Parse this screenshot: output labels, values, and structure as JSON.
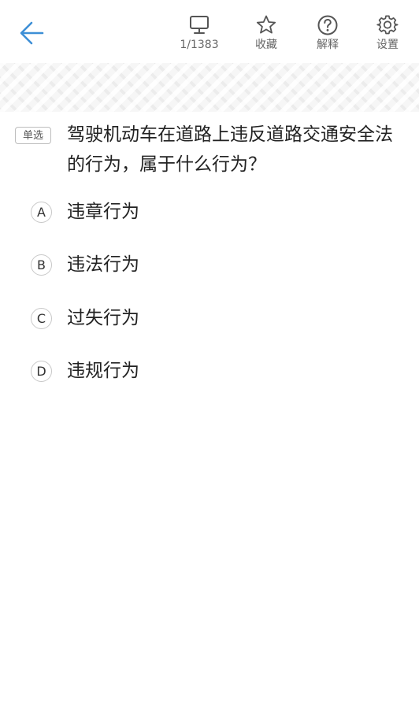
{
  "header": {
    "back_icon": "arrow-left-icon",
    "accent_color": "#3d8fd6",
    "tools": [
      {
        "icon": "monitor-icon",
        "label": "1/1383"
      },
      {
        "icon": "star-icon",
        "label": "收藏"
      },
      {
        "icon": "question-circle-icon",
        "label": "解释"
      },
      {
        "icon": "gear-icon",
        "label": "设置"
      }
    ]
  },
  "question": {
    "type": "单选",
    "text": "驾驶机动车在道路上违反道路交通安全法的行为，属于什么行为？",
    "options": [
      {
        "letter": "A",
        "text": "违章行为"
      },
      {
        "letter": "B",
        "text": "违法行为"
      },
      {
        "letter": "C",
        "text": "过失行为"
      },
      {
        "letter": "D",
        "text": "违规行为"
      }
    ]
  }
}
